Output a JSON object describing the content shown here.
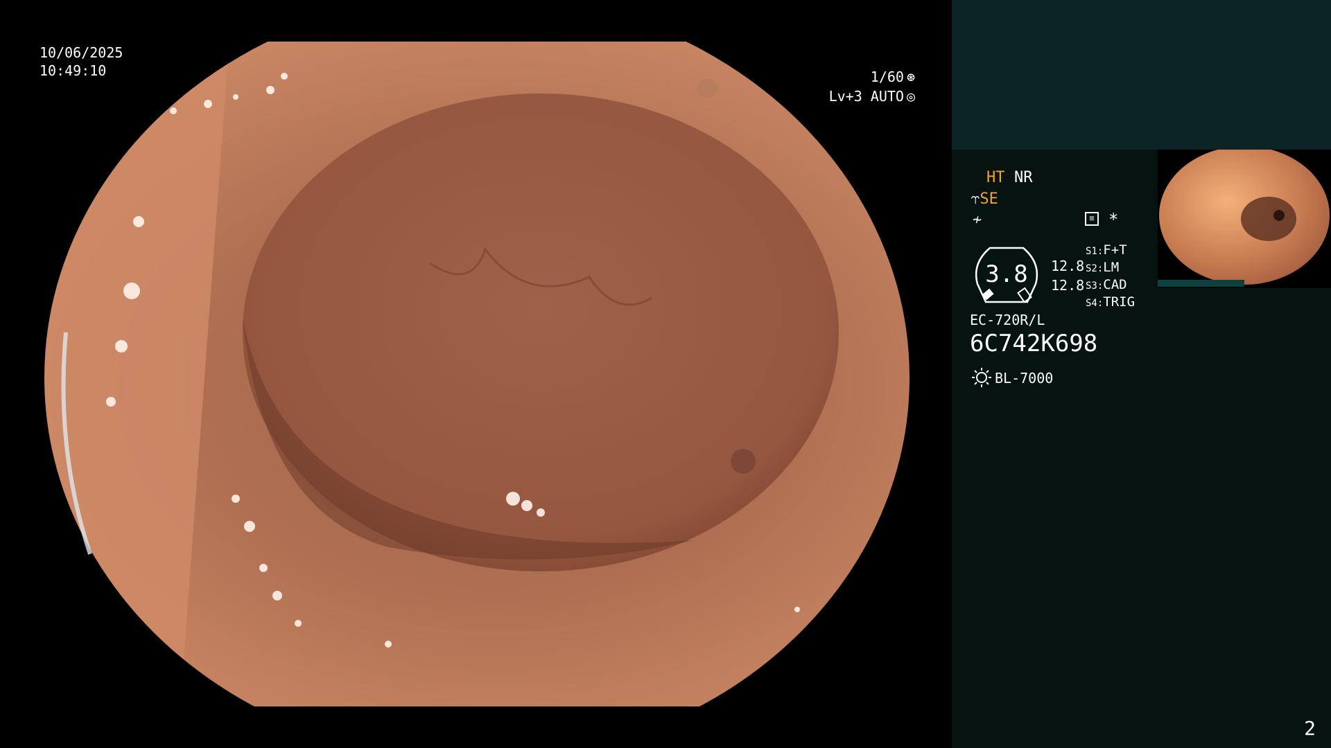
{
  "overlay": {
    "date": "10/06/2025",
    "time": "10:49:10",
    "shutter": "1/60",
    "level": "Lv+3 AUTO"
  },
  "panel": {
    "ht": "HT",
    "nr": "NR",
    "se": "SE",
    "gauge_value": "3.8",
    "distance_1": "12.8",
    "distance_2": "12.8",
    "switches": [
      {
        "key": "S1:",
        "label": "F+T"
      },
      {
        "key": "S2:",
        "label": "LM"
      },
      {
        "key": "S3:",
        "label": "CAD"
      },
      {
        "key": "S4:",
        "label": "TRIG"
      }
    ],
    "scope_model": "EC-720R/L",
    "scope_serial": "6C742K698",
    "light_source": "BL-7000"
  },
  "page_number": "2",
  "colors": {
    "accent_orange": "#f2a42c",
    "panel_bg": "#061311",
    "panel_top_bg": "#0c2425"
  },
  "icons": [
    "shutter-icon",
    "auto-iris-icon",
    "scope-icon",
    "frequency-icon",
    "memo-icon",
    "light-source-icon"
  ]
}
